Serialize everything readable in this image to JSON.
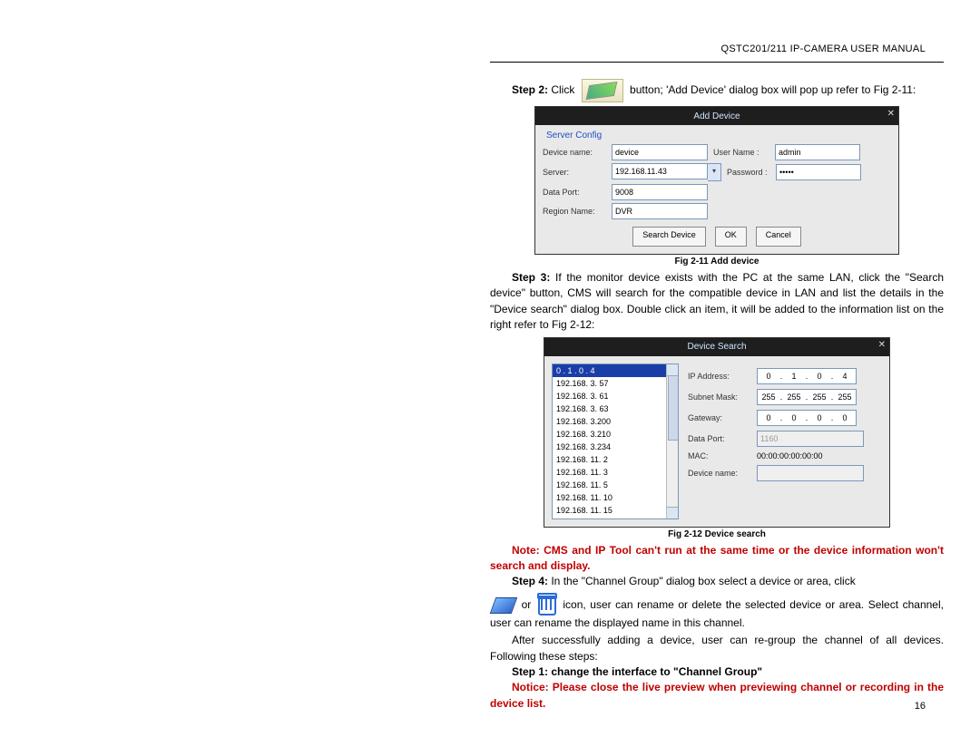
{
  "header": {
    "title": "QSTC201/211 IP-CAMERA USER MANUAL"
  },
  "step2": {
    "prefix": "Step 2:",
    "text1": " Click ",
    "text2": " button; 'Add Device' dialog box will pop up refer to Fig 2-11:"
  },
  "dialog1": {
    "title": "Add Device",
    "group": "Server Config",
    "labels": {
      "device_name": "Device name:",
      "user_name": "User Name :",
      "server": "Server:",
      "password": "Password :",
      "data_port": "Data Port:",
      "region": "Region Name:"
    },
    "values": {
      "device_name": "device",
      "user_name": "admin",
      "server": "192.168.11.43",
      "password": "•••••",
      "data_port": "9008",
      "region": "DVR"
    },
    "buttons": {
      "search": "Search Device",
      "ok": "OK",
      "cancel": "Cancel"
    }
  },
  "caption1": "Fig 2-11 Add device",
  "step3": {
    "prefix": "Step 3:",
    "text": " If the monitor device exists with the PC at the same LAN, click the \"Search device\" button, CMS will search for the compatible device in LAN and list the details in the \"Device search\" dialog box. Double click an item, it will be added to the information list on the right refer to Fig 2-12:"
  },
  "dialog2": {
    "title": "Device Search",
    "list": [
      "0 . 1 . 0 . 4",
      "192.168. 3. 57",
      "192.168. 3. 61",
      "192.168. 3. 63",
      "192.168. 3.200",
      "192.168. 3.210",
      "192.168. 3.234",
      "192.168. 11.  2",
      "192.168. 11.  3",
      "192.168. 11.  5",
      "192.168. 11. 10",
      "192.168. 11. 15"
    ],
    "labels": {
      "ip": "IP Address:",
      "mask": "Subnet Mask:",
      "gw": "Gateway:",
      "port": "Data Port:",
      "mac": "MAC:",
      "name": "Device name:"
    },
    "values": {
      "ip": [
        "0",
        "1",
        "0",
        "4"
      ],
      "mask": [
        "255",
        "255",
        "255",
        "255"
      ],
      "gw": [
        "0",
        "0",
        "0",
        "0"
      ],
      "port": "1160",
      "mac": "00:00:00:00:00:00",
      "name": ""
    }
  },
  "caption2": "Fig 2-12 Device search",
  "note": "Note: CMS and IP Tool can't run at the same time or the device information won't search and display.",
  "step4": {
    "prefix": "Step 4:",
    "text1": " In the \"Channel Group\" dialog box select a device or area, click ",
    "text2": "or",
    "text3": " icon, user can rename or delete the selected device or area. Select channel, user can rename the displayed name in this channel."
  },
  "after_add": "After successfully adding a device, user can re-group the channel of all devices. Following these steps:",
  "step1b": "Step 1: change the interface to \"Channel Group\"",
  "notice": "Notice: Please close the live preview when previewing channel or recording in the device list.",
  "page_num": "16"
}
